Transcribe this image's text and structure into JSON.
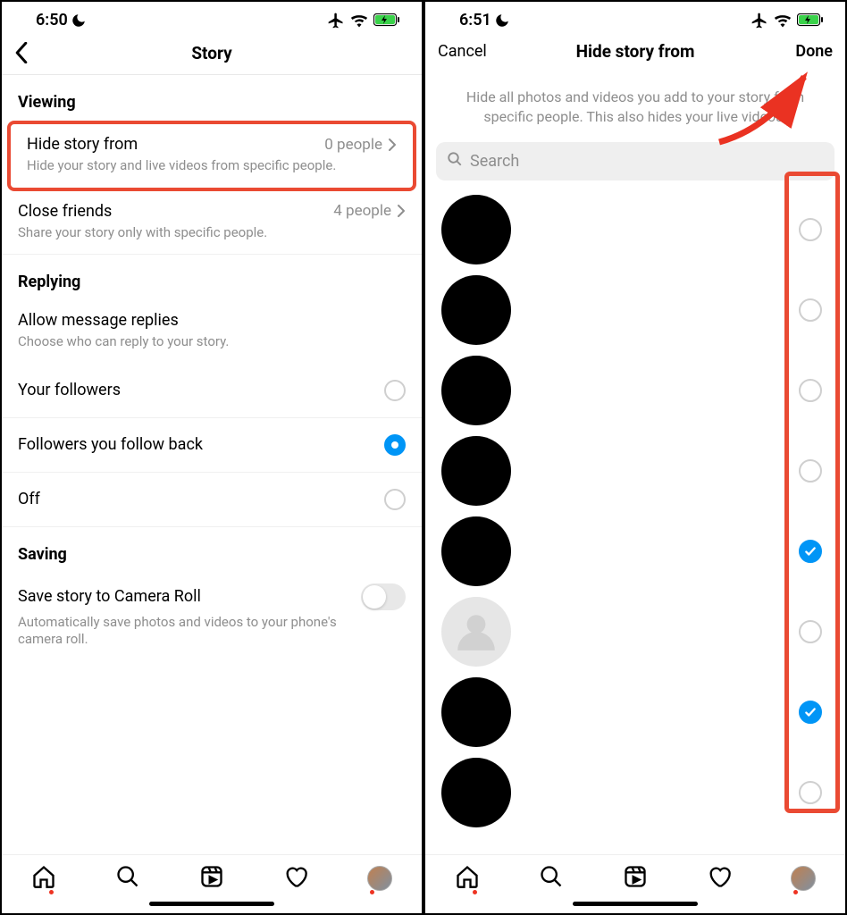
{
  "left": {
    "status": {
      "time": "6:50"
    },
    "nav": {
      "title": "Story"
    },
    "sections": {
      "viewing": "Viewing",
      "replying": "Replying",
      "saving": "Saving"
    },
    "hideStory": {
      "title": "Hide story from",
      "detail": "0 people",
      "sub": "Hide your story and live videos from specific people."
    },
    "closeFriends": {
      "title": "Close friends",
      "detail": "4 people",
      "sub": "Share your story only with specific people."
    },
    "allowReplies": {
      "title": "Allow message replies",
      "sub": "Choose who can reply to your story."
    },
    "replyOptions": {
      "followers": "Your followers",
      "followBack": "Followers you follow back",
      "off": "Off"
    },
    "saveStory": {
      "title": "Save story to Camera Roll",
      "sub": "Automatically save photos and videos to your phone's camera roll."
    }
  },
  "right": {
    "status": {
      "time": "6:51"
    },
    "nav": {
      "cancel": "Cancel",
      "title": "Hide story from",
      "done": "Done"
    },
    "helper": "Hide all photos and videos you add to your story from specific people. This also hides your live videos.",
    "search": {
      "placeholder": "Search"
    },
    "people": [
      {
        "avatar": "black",
        "checked": false
      },
      {
        "avatar": "black",
        "checked": false
      },
      {
        "avatar": "black",
        "checked": false
      },
      {
        "avatar": "black",
        "checked": false
      },
      {
        "avatar": "black",
        "checked": true
      },
      {
        "avatar": "placeholder",
        "checked": false
      },
      {
        "avatar": "black",
        "checked": true
      },
      {
        "avatar": "black",
        "checked": false
      }
    ]
  }
}
